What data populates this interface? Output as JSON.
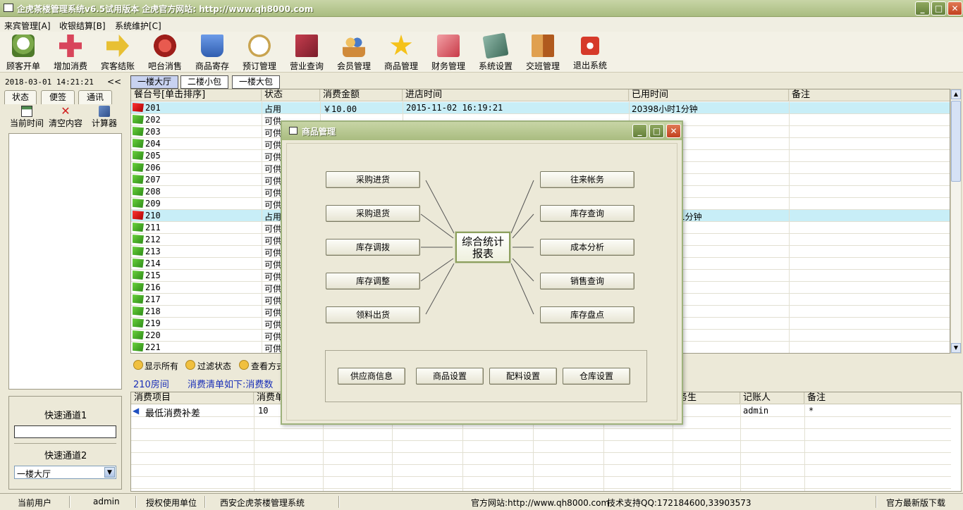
{
  "window": {
    "title": "企虎茶楼管理系统v6.5试用版本 企虎官方网站: http://www.qh8000.com",
    "btn_min": "_",
    "btn_max": "□",
    "btn_close": "✕"
  },
  "menu": [
    "来宾管理[A]",
    "收银结算[B]",
    "系统维护[C]"
  ],
  "toolbar": [
    {
      "label": "顾客开单",
      "icon": "teacup-icon",
      "color": "#6E9B3F"
    },
    {
      "label": "增加消费",
      "icon": "plus-icon",
      "color": "#D8455B"
    },
    {
      "label": "宾客结账",
      "icon": "arrow-icon",
      "color": "#E8C033"
    },
    {
      "label": "吧台消售",
      "icon": "bar-counter-icon",
      "color": "#B8302A"
    },
    {
      "label": "商品寄存",
      "icon": "basket-icon",
      "color": "#3F73C8"
    },
    {
      "label": "预订管理",
      "icon": "clock-icon",
      "color": "#C9A450"
    },
    {
      "label": "营业查询",
      "icon": "report-icon",
      "color": "#B03A4A"
    },
    {
      "label": "会员管理",
      "icon": "members-icon",
      "color": "#D08A3A"
    },
    {
      "label": "商品管理",
      "icon": "star-icon",
      "color": "#F5C21A"
    },
    {
      "label": "财务管理",
      "icon": "finance-icon",
      "color": "#D6505A"
    },
    {
      "label": "系统设置",
      "icon": "settings-icon",
      "color": "#5B8A7A"
    },
    {
      "label": "交班管理",
      "icon": "handover-icon",
      "color": "#C77A2E"
    },
    {
      "label": "退出系统",
      "icon": "power-icon",
      "color": "#D63A2A"
    }
  ],
  "left": {
    "datetime": "2018-03-01 14:21:21",
    "collapse": "<<",
    "tabs": [
      "状态",
      "便签",
      "通讯"
    ],
    "tools": [
      {
        "label": "当前时间",
        "icon": "calendar-icon"
      },
      {
        "label": "清空内容",
        "icon": "clear-icon"
      },
      {
        "label": "计算器",
        "icon": "calculator-icon"
      }
    ],
    "quick1_label": "快速通道1",
    "quick1_value": "",
    "quick2_label": "快速通道2",
    "quick2_value": "一楼大厅"
  },
  "room_tabs": [
    "一楼大厅",
    "二楼小包",
    "一楼大包"
  ],
  "grid": {
    "headers": [
      "餐台号[单击排序]",
      "状态",
      "消费金额",
      "进店时间",
      "已用时间",
      "备注"
    ],
    "rows": [
      {
        "id": "201",
        "status": "占用",
        "amount": "￥10.00",
        "time": "2015-11-02 16:19:21",
        "used": "20398小时1分钟",
        "occupied": true,
        "selected": true
      },
      {
        "id": "202",
        "status": "可供",
        "occupied": false
      },
      {
        "id": "203",
        "status": "可供",
        "occupied": false
      },
      {
        "id": "204",
        "status": "可供",
        "occupied": false
      },
      {
        "id": "205",
        "status": "可供",
        "occupied": false
      },
      {
        "id": "206",
        "status": "可供",
        "occupied": false
      },
      {
        "id": "207",
        "status": "可供",
        "occupied": false
      },
      {
        "id": "208",
        "status": "可供",
        "occupied": false
      },
      {
        "id": "209",
        "status": "可供",
        "occupied": false
      },
      {
        "id": "210",
        "status": "占用",
        "used_partial": "1分钟",
        "occupied": true,
        "selected": true
      },
      {
        "id": "211",
        "status": "可供",
        "occupied": false
      },
      {
        "id": "212",
        "status": "可供",
        "occupied": false
      },
      {
        "id": "213",
        "status": "可供",
        "occupied": false
      },
      {
        "id": "214",
        "status": "可供",
        "occupied": false
      },
      {
        "id": "215",
        "status": "可供",
        "occupied": false
      },
      {
        "id": "216",
        "status": "可供",
        "occupied": false
      },
      {
        "id": "217",
        "status": "可供",
        "occupied": false
      },
      {
        "id": "218",
        "status": "可供",
        "occupied": false
      },
      {
        "id": "219",
        "status": "可供",
        "occupied": false
      },
      {
        "id": "220",
        "status": "可供",
        "occupied": false
      },
      {
        "id": "221",
        "status": "可供",
        "occupied": false
      }
    ]
  },
  "midbar": [
    "显示所有",
    "过滤状态",
    "查看方式"
  ],
  "bluebar": {
    "room": "210房间",
    "info": "消费清单如下:消费数"
  },
  "lower": {
    "headers": [
      "消费项目",
      "消费单",
      "务生",
      "记账人",
      "备注"
    ],
    "row": {
      "item": "最低消费补差",
      "qty": "10",
      "clerk": "admin",
      "note": "*"
    }
  },
  "status": {
    "user_label": "当前用户",
    "user": "admin",
    "unit_label": "授权使用单位",
    "unit": "西安企虎茶楼管理系统",
    "website": "官方网站:http://www.qh8000.com",
    "support": "技术支持QQ:172184600,33903573",
    "download": "官方最新版下载"
  },
  "dialog": {
    "title": "商品管理",
    "left_buttons": [
      "采购进货",
      "采购退货",
      "库存调拨",
      "库存调整",
      "领料出货"
    ],
    "right_buttons": [
      "往来帐务",
      "库存查询",
      "成本分析",
      "销售查询",
      "库存盘点"
    ],
    "center_line1": "综合统计",
    "center_line2": "报表",
    "bottom_buttons": [
      "供应商信息",
      "商品设置",
      "配料设置",
      "仓库设置"
    ]
  }
}
